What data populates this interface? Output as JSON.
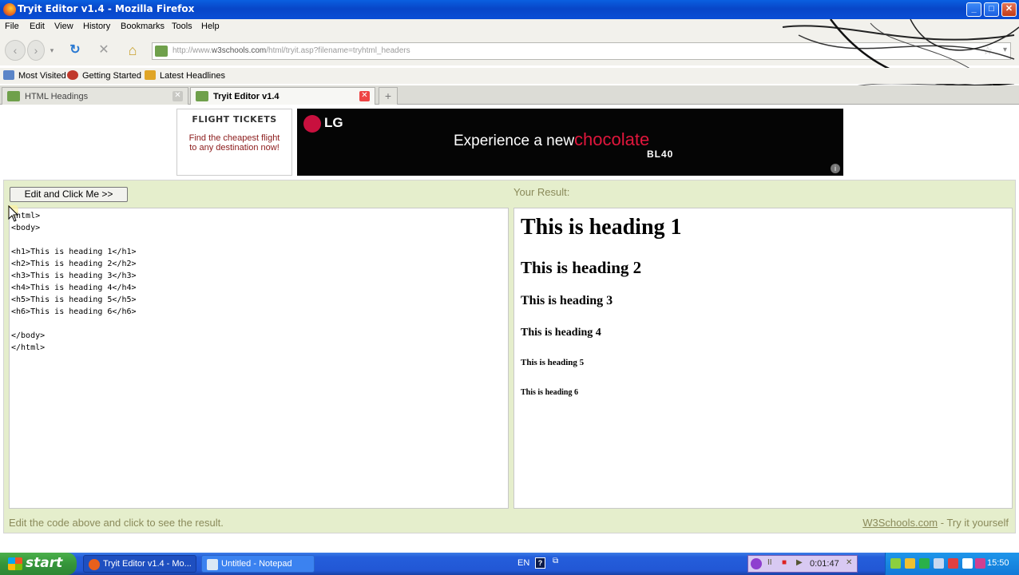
{
  "window": {
    "title": "Tryit Editor v1.4 - Mozilla Firefox",
    "min_label": "_",
    "max_label": "□",
    "close_label": "✕"
  },
  "menu": {
    "items": [
      "File",
      "Edit",
      "View",
      "History",
      "Bookmarks",
      "Tools",
      "Help"
    ]
  },
  "nav": {
    "back_label": "‹",
    "forward_label": "›",
    "dropdown_label": "▾",
    "reload_label": "↻",
    "stop_label": "✕",
    "home_label": "⌂",
    "url_prefix": "http://www.",
    "url_domain": "w3schools.com",
    "url_path": "/html/tryit.asp?filename=tryhtml_headers",
    "star_label": "☆",
    "url_dropdown_label": "▾"
  },
  "bookmarks": {
    "items": [
      "Most Visited",
      "Getting Started",
      "Latest Headlines"
    ]
  },
  "tabs": {
    "items": [
      {
        "label": "HTML Headings",
        "close": "✕"
      },
      {
        "label": "Tryit Editor v1.4",
        "close": "✕"
      }
    ],
    "new_tab_label": "+"
  },
  "ads": {
    "flight_title": "FLIGHT TICKETS",
    "flight_desc": "Find the cheapest flight to any destination now!",
    "lg_logo": "LG",
    "lg_tag_prefix": "Experience a new",
    "lg_tag_highlight": "chocolate",
    "lg_model": "BL40",
    "info_label": "i"
  },
  "editor": {
    "button_label": "Edit and Click Me >>",
    "result_label": "Your Result:",
    "code": "<html>\n<body>\n\n<h1>This is heading 1</h1>\n<h2>This is heading 2</h2>\n<h3>This is heading 3</h3>\n<h4>This is heading 4</h4>\n<h5>This is heading 5</h5>\n<h6>This is heading 6</h6>\n\n</body>\n</html>",
    "results": [
      "This is heading 1",
      "This is heading 2",
      "This is heading 3",
      "This is heading 4",
      "This is heading 5",
      "This is heading 6"
    ],
    "footer_left": "Edit the code above and click to see the result.",
    "footer_link": "W3Schools.com",
    "footer_suffix": " - Try it yourself"
  },
  "taskbar": {
    "start_label": "start",
    "items": [
      {
        "label": "Tryit Editor v1.4 - Mo..."
      },
      {
        "label": "Untitled - Notepad"
      }
    ],
    "language": "EN",
    "help_label": "?",
    "rec_pause": "II",
    "rec_stop": "■",
    "rec_play": "▶",
    "rec_time": "0:01:47",
    "rec_close": "✕",
    "clock": "15:50"
  },
  "colors": {
    "accent_green": "#e5eecc",
    "title_blue": "#0846c8",
    "lg_red": "#e0163c"
  }
}
